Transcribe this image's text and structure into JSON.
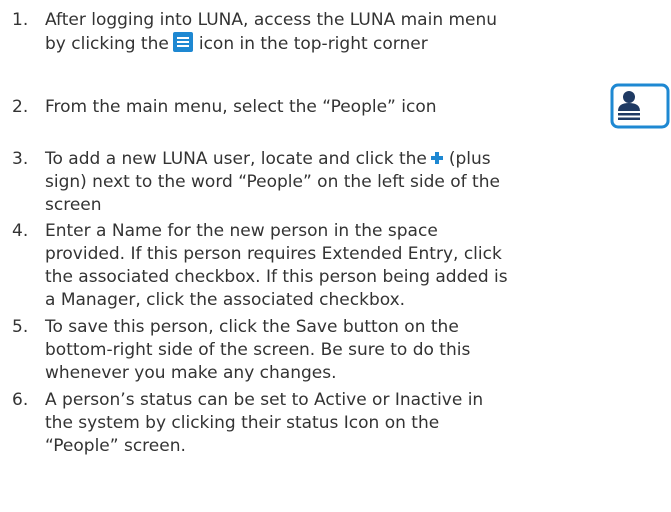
{
  "steps": [
    {
      "number": "1.",
      "lines": [
        "After logging into LUNA, access the LUNA main menu",
        {
          "before": "by clicking the",
          "icon": "hamburger-menu-icon",
          "after": "icon in the top-right corner"
        }
      ]
    },
    {
      "number": "2.",
      "lines": [
        "From the main menu, select the “People” icon"
      ],
      "trailing_icon": "people-card-icon"
    },
    {
      "number": "3.",
      "lines": [
        {
          "before": "To add a new LUNA user, locate and click the",
          "icon": "plus-icon",
          "after": "(plus"
        },
        "sign) next to the word “People” on the left side of the",
        "screen"
      ]
    },
    {
      "number": "4.",
      "lines": [
        "Enter a Name for the new person in the space",
        "provided.  If this person requires Extended Entry, click",
        "the associated checkbox.  If this person being added is",
        "a Manager, click the associated checkbox."
      ]
    },
    {
      "number": "5.",
      "lines": [
        "To save this person, click the Save button on the",
        "bottom-right side of the screen.  Be sure to do this",
        "whenever you make any changes."
      ]
    },
    {
      "number": "6.",
      "lines": [
        "A person’s status can be set to Active or Inactive in",
        "the system by clicking their status Icon on the",
        "“People” screen."
      ]
    }
  ],
  "colors": {
    "text": "#333333",
    "accent_blue": "#1e88d2",
    "icon_navy": "#1f3a63"
  }
}
